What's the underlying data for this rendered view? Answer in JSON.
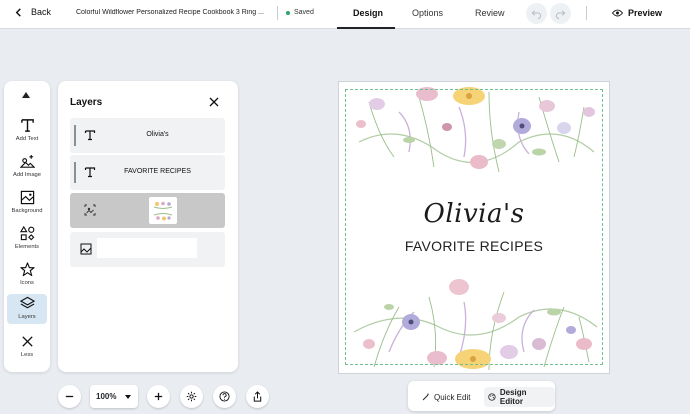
{
  "header": {
    "back_label": "Back",
    "document_title": "Colorful Wildflower Personalized Recipe Cookbook 3 Ring ...",
    "save_status": "Saved",
    "tabs": [
      {
        "label": "Design",
        "active": true
      },
      {
        "label": "Options",
        "active": false
      },
      {
        "label": "Review",
        "active": false
      }
    ],
    "preview_label": "Preview"
  },
  "tools": [
    {
      "label": "",
      "icon": "chevron-up-icon"
    },
    {
      "label": "Add Text",
      "icon": "text-icon"
    },
    {
      "label": "Add Image",
      "icon": "add-image-icon"
    },
    {
      "label": "Background",
      "icon": "background-icon"
    },
    {
      "label": "Elements",
      "icon": "elements-icon"
    },
    {
      "label": "Icons",
      "icon": "star-icon"
    },
    {
      "label": "Layers",
      "icon": "layers-icon",
      "active": true
    },
    {
      "label": "Less",
      "icon": "close-icon"
    }
  ],
  "layers_panel": {
    "title": "Layers",
    "items": [
      {
        "type": "text",
        "label": "Olivia's"
      },
      {
        "type": "text",
        "label": "FAVORITE RECIPES"
      },
      {
        "type": "image",
        "label": "",
        "selected": true
      },
      {
        "type": "background",
        "label": ""
      }
    ]
  },
  "zoom": {
    "value": "100%"
  },
  "canvas": {
    "name_text": "Olivia's",
    "subtitle_text": "FAVORITE RECIPES"
  },
  "modes": [
    {
      "label": "Quick Edit",
      "active": false
    },
    {
      "label": "Design Editor",
      "active": true
    }
  ],
  "colors": {
    "accent_selected": "#d6e7f3",
    "saved_dot": "#2ea56a",
    "layer_selected": "#c8c8c8",
    "safe_zone": "#6fbf8f"
  }
}
